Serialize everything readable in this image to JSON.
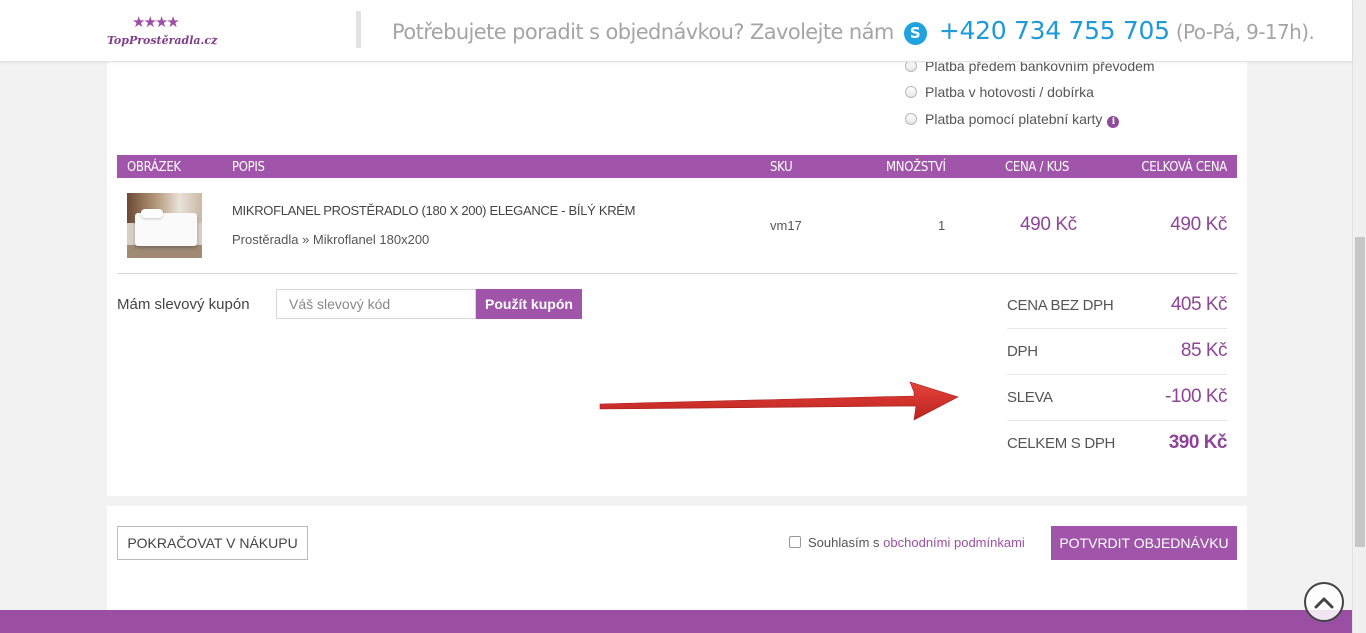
{
  "header": {
    "logo_text": "TopProstěradla.cz",
    "phone_prompt": "Potřebujete poradit s objednávkou? Zavolejte nám",
    "skype_glyph": "S",
    "phone_number": "+420 734 755 705",
    "phone_hours": "(Po-Pá, 9-17h).",
    "icons": [
      "logo-stars",
      "skype-icon"
    ]
  },
  "payment_options": [
    "Platba předem bankovním převodem",
    "Platba v hotovosti / dobírka",
    "Platba pomocí platební karty"
  ],
  "table": {
    "headers": [
      "OBRÁZEK",
      "POPIS",
      "SKU",
      "MNOŽSTVÍ",
      "CENA / KUS",
      "CELKOVÁ CENA"
    ],
    "rows": [
      {
        "name": "MIKROFLANEL PROSTĚRADLO (180 X 200) ELEGANCE - BÍLÝ KRÉM",
        "category": "Prostěradla » Mikroflanel 180x200",
        "sku": "vm17",
        "quantity": "1",
        "unit_price": "490 Kč",
        "total_price": "490 Kč"
      }
    ]
  },
  "coupon": {
    "label": "Mám slevový kupón",
    "placeholder": "Váš slevový kód",
    "button": "Použít kupón"
  },
  "summary": [
    {
      "label": "CENA BEZ DPH",
      "value": "405 Kč"
    },
    {
      "label": "DPH",
      "value": "85 Kč"
    },
    {
      "label": "SLEVA",
      "value": "-100 Kč"
    },
    {
      "label": "CELKEM S DPH",
      "value": "390 Kč"
    }
  ],
  "actions": {
    "continue": "POKRAČOVAT V NÁKUPU",
    "agree_prefix": "Souhlasím s",
    "agree_link": "obchodními podmínkami",
    "confirm": "POTVRDIT OBJEDNÁVKU"
  },
  "colors": {
    "accent": "#a055aa",
    "price": "#8e4597",
    "phone": "#1e9ad8",
    "arrow": "#d8231f"
  }
}
